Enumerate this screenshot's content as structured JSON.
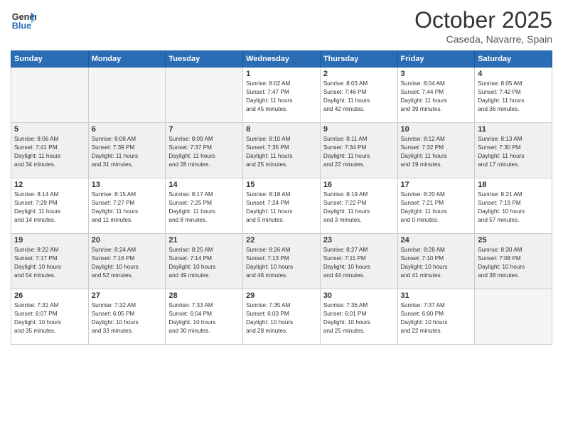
{
  "header": {
    "logo_general": "General",
    "logo_blue": "Blue",
    "month_title": "October 2025",
    "location": "Caseda, Navarre, Spain"
  },
  "weekdays": [
    "Sunday",
    "Monday",
    "Tuesday",
    "Wednesday",
    "Thursday",
    "Friday",
    "Saturday"
  ],
  "weeks": [
    [
      {
        "day": "",
        "info": "",
        "empty": true
      },
      {
        "day": "",
        "info": "",
        "empty": true
      },
      {
        "day": "",
        "info": "",
        "empty": true
      },
      {
        "day": "1",
        "info": "Sunrise: 8:02 AM\nSunset: 7:47 PM\nDaylight: 11 hours\nand 45 minutes.",
        "empty": false
      },
      {
        "day": "2",
        "info": "Sunrise: 8:03 AM\nSunset: 7:46 PM\nDaylight: 11 hours\nand 42 minutes.",
        "empty": false
      },
      {
        "day": "3",
        "info": "Sunrise: 8:04 AM\nSunset: 7:44 PM\nDaylight: 11 hours\nand 39 minutes.",
        "empty": false
      },
      {
        "day": "4",
        "info": "Sunrise: 8:05 AM\nSunset: 7:42 PM\nDaylight: 11 hours\nand 36 minutes.",
        "empty": false
      }
    ],
    [
      {
        "day": "5",
        "info": "Sunrise: 8:06 AM\nSunset: 7:41 PM\nDaylight: 11 hours\nand 34 minutes.",
        "empty": false
      },
      {
        "day": "6",
        "info": "Sunrise: 8:08 AM\nSunset: 7:39 PM\nDaylight: 11 hours\nand 31 minutes.",
        "empty": false
      },
      {
        "day": "7",
        "info": "Sunrise: 8:09 AM\nSunset: 7:37 PM\nDaylight: 11 hours\nand 28 minutes.",
        "empty": false
      },
      {
        "day": "8",
        "info": "Sunrise: 8:10 AM\nSunset: 7:35 PM\nDaylight: 11 hours\nand 25 minutes.",
        "empty": false
      },
      {
        "day": "9",
        "info": "Sunrise: 8:11 AM\nSunset: 7:34 PM\nDaylight: 11 hours\nand 22 minutes.",
        "empty": false
      },
      {
        "day": "10",
        "info": "Sunrise: 8:12 AM\nSunset: 7:32 PM\nDaylight: 11 hours\nand 19 minutes.",
        "empty": false
      },
      {
        "day": "11",
        "info": "Sunrise: 8:13 AM\nSunset: 7:30 PM\nDaylight: 11 hours\nand 17 minutes.",
        "empty": false
      }
    ],
    [
      {
        "day": "12",
        "info": "Sunrise: 8:14 AM\nSunset: 7:29 PM\nDaylight: 11 hours\nand 14 minutes.",
        "empty": false
      },
      {
        "day": "13",
        "info": "Sunrise: 8:15 AM\nSunset: 7:27 PM\nDaylight: 11 hours\nand 11 minutes.",
        "empty": false
      },
      {
        "day": "14",
        "info": "Sunrise: 8:17 AM\nSunset: 7:25 PM\nDaylight: 11 hours\nand 8 minutes.",
        "empty": false
      },
      {
        "day": "15",
        "info": "Sunrise: 8:18 AM\nSunset: 7:24 PM\nDaylight: 11 hours\nand 5 minutes.",
        "empty": false
      },
      {
        "day": "16",
        "info": "Sunrise: 8:19 AM\nSunset: 7:22 PM\nDaylight: 11 hours\nand 3 minutes.",
        "empty": false
      },
      {
        "day": "17",
        "info": "Sunrise: 8:20 AM\nSunset: 7:21 PM\nDaylight: 11 hours\nand 0 minutes.",
        "empty": false
      },
      {
        "day": "18",
        "info": "Sunrise: 8:21 AM\nSunset: 7:19 PM\nDaylight: 10 hours\nand 57 minutes.",
        "empty": false
      }
    ],
    [
      {
        "day": "19",
        "info": "Sunrise: 8:22 AM\nSunset: 7:17 PM\nDaylight: 10 hours\nand 54 minutes.",
        "empty": false
      },
      {
        "day": "20",
        "info": "Sunrise: 8:24 AM\nSunset: 7:16 PM\nDaylight: 10 hours\nand 52 minutes.",
        "empty": false
      },
      {
        "day": "21",
        "info": "Sunrise: 8:25 AM\nSunset: 7:14 PM\nDaylight: 10 hours\nand 49 minutes.",
        "empty": false
      },
      {
        "day": "22",
        "info": "Sunrise: 8:26 AM\nSunset: 7:13 PM\nDaylight: 10 hours\nand 46 minutes.",
        "empty": false
      },
      {
        "day": "23",
        "info": "Sunrise: 8:27 AM\nSunset: 7:11 PM\nDaylight: 10 hours\nand 44 minutes.",
        "empty": false
      },
      {
        "day": "24",
        "info": "Sunrise: 8:28 AM\nSunset: 7:10 PM\nDaylight: 10 hours\nand 41 minutes.",
        "empty": false
      },
      {
        "day": "25",
        "info": "Sunrise: 8:30 AM\nSunset: 7:08 PM\nDaylight: 10 hours\nand 38 minutes.",
        "empty": false
      }
    ],
    [
      {
        "day": "26",
        "info": "Sunrise: 7:31 AM\nSunset: 6:07 PM\nDaylight: 10 hours\nand 35 minutes.",
        "empty": false
      },
      {
        "day": "27",
        "info": "Sunrise: 7:32 AM\nSunset: 6:05 PM\nDaylight: 10 hours\nand 33 minutes.",
        "empty": false
      },
      {
        "day": "28",
        "info": "Sunrise: 7:33 AM\nSunset: 6:04 PM\nDaylight: 10 hours\nand 30 minutes.",
        "empty": false
      },
      {
        "day": "29",
        "info": "Sunrise: 7:35 AM\nSunset: 6:03 PM\nDaylight: 10 hours\nand 28 minutes.",
        "empty": false
      },
      {
        "day": "30",
        "info": "Sunrise: 7:36 AM\nSunset: 6:01 PM\nDaylight: 10 hours\nand 25 minutes.",
        "empty": false
      },
      {
        "day": "31",
        "info": "Sunrise: 7:37 AM\nSunset: 6:00 PM\nDaylight: 10 hours\nand 22 minutes.",
        "empty": false
      },
      {
        "day": "",
        "info": "",
        "empty": true
      }
    ]
  ]
}
